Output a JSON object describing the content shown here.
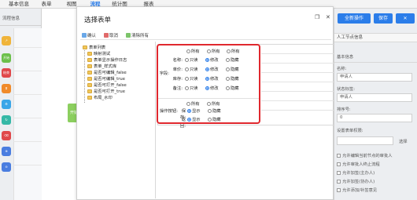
{
  "top_nav": {
    "tabs": [
      {
        "label": "基本信息"
      },
      {
        "label": "表单"
      },
      {
        "label": "视图"
      },
      {
        "label": "流程"
      },
      {
        "label": "统计图"
      },
      {
        "label": "报表"
      }
    ],
    "active_index": 3
  },
  "left_panel": {
    "header": "流程信息",
    "tools": [
      {
        "icon": "arrow-icon",
        "color": "#f0b43a"
      },
      {
        "icon": "start-icon",
        "color": "#6cc04a",
        "label": "开始"
      },
      {
        "icon": "end-icon",
        "color": "#e0484a",
        "label": "结束"
      },
      {
        "icon": "task-icon",
        "color": "#f08a2a"
      },
      {
        "icon": "gear-icon",
        "color": "#3aa6e8"
      },
      {
        "icon": "subflow-icon",
        "color": "#35b8a6"
      },
      {
        "icon": "eraser-icon",
        "color": "#e0484a"
      },
      {
        "icon": "zoom-in-icon",
        "color": "#4a7de0"
      },
      {
        "icon": "zoom-out-icon",
        "color": "#4a7de0"
      }
    ]
  },
  "canvas": {
    "node_label": "开始"
  },
  "modal": {
    "title": "选择表单",
    "toolbar": {
      "confirm": "确认",
      "cancel": "取消",
      "clear_all": "清除所有"
    },
    "tree": [
      "表单列表",
      "映射测试",
      "表单显示操作日志",
      "表单_样式库",
      "是否可编辑_false",
      "是否可编辑_true",
      "是否可打开_false",
      "是否可打开_true",
      "布局_水印"
    ],
    "field_section_label": "字段:",
    "field_headers": [
      "所有",
      "所有",
      "所有"
    ],
    "fields": [
      {
        "name": "名称:",
        "selected": 1
      },
      {
        "name": "单价:",
        "selected": 1
      },
      {
        "name": "库存:",
        "selected": 1
      },
      {
        "name": "备注:",
        "selected": 1
      }
    ],
    "field_options": [
      "只读",
      "修改",
      "隐藏"
    ],
    "button_section_label": "操作按钮:",
    "button_headers": [
      "所有",
      "所有"
    ],
    "buttons": [
      {
        "name": "保存:",
        "selected": 0
      },
      {
        "name": "返回:",
        "selected": 0
      }
    ],
    "button_options": [
      "显示",
      "隐藏"
    ]
  },
  "right_panel": {
    "actions": {
      "full_new": "全新操作",
      "save": "保存"
    },
    "section_title": "人工节点信息",
    "basic_info": "基本信息",
    "name_label": "名称:",
    "name_value": "申请人",
    "status_label": "状态标签:",
    "status_value": "申请人",
    "order_label": "排序号:",
    "order_value": "0",
    "form_perm_label": "设置表单权限:",
    "select_label": "选择",
    "checks": [
      "允许编辑当前节点的审批人",
      "允许审批人终止流程",
      "允许加签(主办人)",
      "允许加签(协办人)",
      "允许添加/补签意见"
    ],
    "colors": {
      "primary": "#2b7de9",
      "highlight": "#e0282e"
    }
  }
}
